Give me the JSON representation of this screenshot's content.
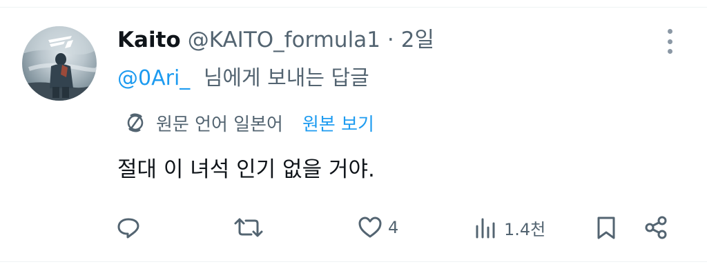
{
  "tweet": {
    "display_name": "Kaito",
    "handle": "@KAITO_formula1",
    "separator": "·",
    "time": "2일",
    "reply_to_mention": "@0Ari_",
    "reply_to_suffix": "님에게 보내는 답글",
    "translation": {
      "label": "원문 언어 일본어",
      "link": "원본 보기"
    },
    "text": "절대 이 녀석 인기 없을 거야."
  },
  "actions": {
    "like_count": "4",
    "views_count": "1.4천"
  },
  "icons": {
    "avatar": "f1-avatar-image",
    "more": "more-vertical-icon",
    "translate": "translate-icon",
    "reply": "reply-icon",
    "retweet": "retweet-icon",
    "like": "heart-icon",
    "views": "views-bar-chart-icon",
    "bookmark": "bookmark-icon",
    "share": "share-icon"
  },
  "colors": {
    "text_primary": "#0f1419",
    "text_secondary": "#536471",
    "accent": "#1d9bf0",
    "divider": "#eff3f4"
  }
}
